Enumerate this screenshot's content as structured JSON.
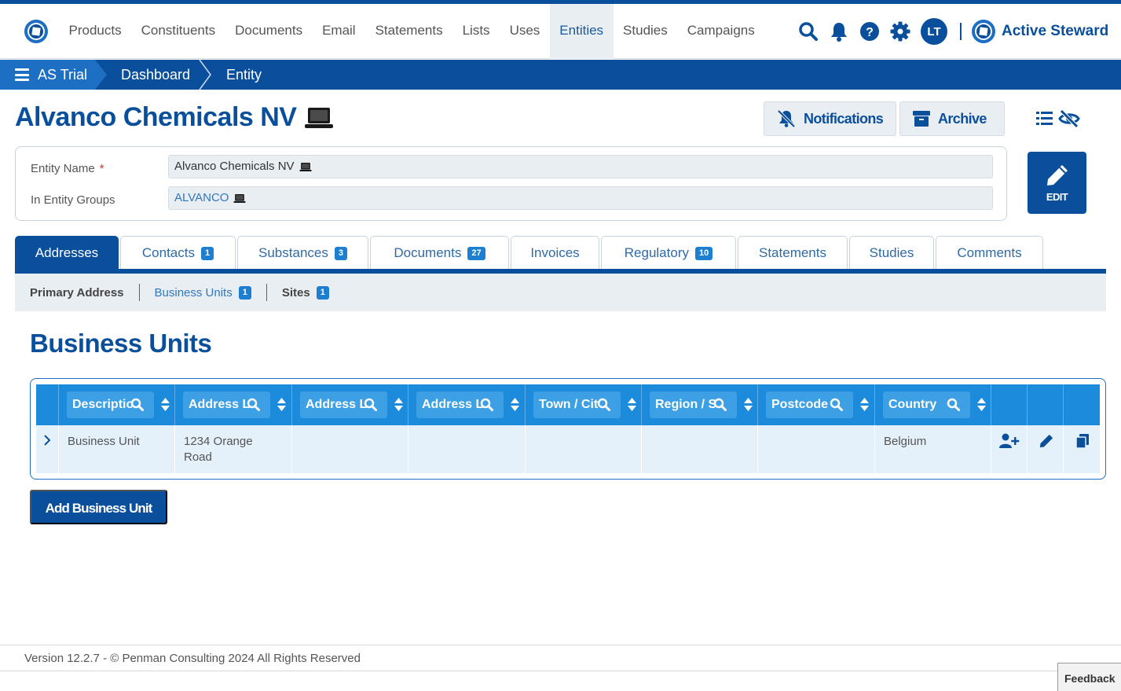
{
  "nav": {
    "items": [
      "Products",
      "Constituents",
      "Documents",
      "Email",
      "Statements",
      "Lists",
      "Uses",
      "Entities",
      "Studies",
      "Campaigns"
    ],
    "active_index": 7,
    "user_initials": "LT",
    "brand": "Active Steward"
  },
  "breadcrumb": {
    "root": "AS Trial",
    "items": [
      "Dashboard",
      "Entity"
    ]
  },
  "page": {
    "title": "Alvanco Chemicals NV",
    "notifications_label": "Notifications",
    "archive_label": "Archive",
    "edit_label": "EDIT"
  },
  "entity": {
    "name_label": "Entity Name",
    "required_mark": "*",
    "name_value": "Alvanco Chemicals NV",
    "groups_label": "In Entity Groups",
    "groups_value": "ALVANCO"
  },
  "tabs": [
    {
      "label": "Addresses",
      "badge": ""
    },
    {
      "label": "Contacts",
      "badge": "1"
    },
    {
      "label": "Substances",
      "badge": "3"
    },
    {
      "label": "Documents",
      "badge": "27"
    },
    {
      "label": "Invoices",
      "badge": ""
    },
    {
      "label": "Regulatory",
      "badge": "10"
    },
    {
      "label": "Statements",
      "badge": ""
    },
    {
      "label": "Studies",
      "badge": ""
    },
    {
      "label": "Comments",
      "badge": ""
    }
  ],
  "subtabs": [
    {
      "label": "Primary Address",
      "badge": ""
    },
    {
      "label": "Business Units",
      "badge": "1"
    },
    {
      "label": "Sites",
      "badge": "1"
    }
  ],
  "section_title": "Business Units",
  "grid": {
    "columns": [
      "Descriptio",
      "Address L",
      "Address L",
      "Address L",
      "Town / Cit",
      "Region / S",
      "Postcode",
      "Country"
    ],
    "rows": [
      {
        "cells": [
          "Business Unit",
          "1234 Orange Road",
          "",
          "",
          "",
          "",
          "",
          "Belgium"
        ]
      }
    ]
  },
  "add_button_label": "Add Business Unit",
  "footer": {
    "text": "Version 12.2.7 - © Penman Consulting 2024 All Rights Reserved",
    "feedback": "Feedback"
  },
  "colors": {
    "brand_blue": "#0a4f9c",
    "accent_blue": "#1d8bdb",
    "badge_blue": "#1d7fd1"
  }
}
